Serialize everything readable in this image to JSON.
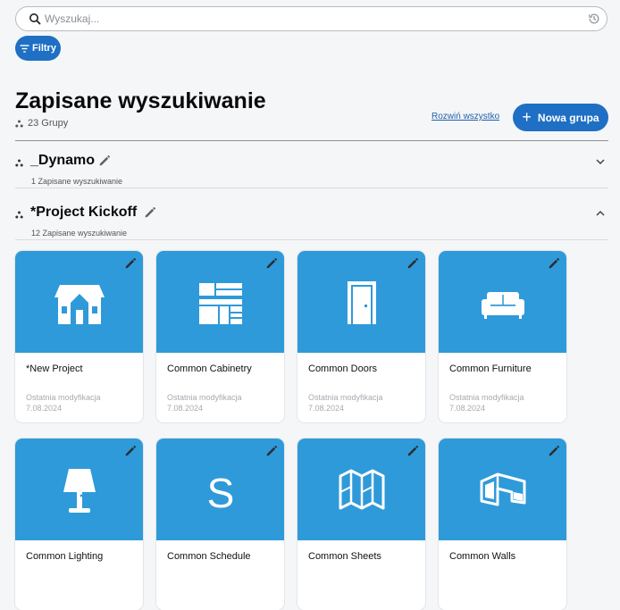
{
  "search": {
    "placeholder": "Wyszukaj...",
    "value": ""
  },
  "filters": {
    "label": "Filtry"
  },
  "header": {
    "title": "Zapisane wyszukiwanie",
    "groups_count": "23 Grupy",
    "expand_all": "Rozwiń wszystko",
    "new_group": "Nowa grupa"
  },
  "groups": [
    {
      "name": "_Dynamo",
      "subtitle": "1 Zapisane wyszukiwanie",
      "expanded": false
    },
    {
      "name": "*Project Kickoff",
      "subtitle": "12 Zapisane wyszukiwanie",
      "expanded": true
    }
  ],
  "cards": [
    {
      "name": "*New Project",
      "icon": "house-icon",
      "modified_label": "Ostatnia modyfikacja",
      "modified_date": "7.08.2024"
    },
    {
      "name": "Common Cabinetry",
      "icon": "cabinetry-icon",
      "modified_label": "Ostatnia modyfikacja",
      "modified_date": "7.08.2024"
    },
    {
      "name": "Common Doors",
      "icon": "door-icon",
      "modified_label": "Ostatnia modyfikacja",
      "modified_date": "7.08.2024"
    },
    {
      "name": "Common Furniture",
      "icon": "sofa-icon",
      "modified_label": "Ostatnia modyfikacja",
      "modified_date": "7.08.2024"
    },
    {
      "name": "Common Lighting",
      "icon": "lamp-icon"
    },
    {
      "name": "Common Schedule",
      "icon": "schedule-icon",
      "glyph": "S"
    },
    {
      "name": "Common Sheets",
      "icon": "sheets-icon"
    },
    {
      "name": "Common Walls",
      "icon": "walls-icon"
    }
  ],
  "colors": {
    "accent": "#1f6fc4",
    "thumb": "#2f9ad9",
    "background": "#f5f6f8"
  }
}
